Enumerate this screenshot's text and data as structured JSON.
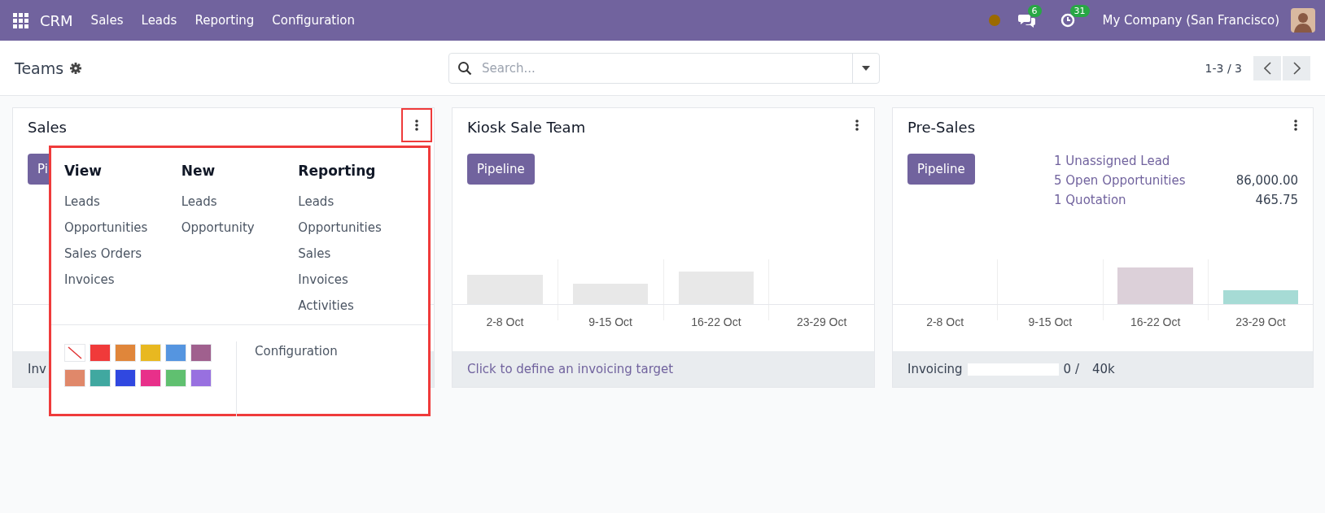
{
  "navbar": {
    "app": "CRM",
    "menus": [
      "Sales",
      "Leads",
      "Reporting",
      "Configuration"
    ],
    "messages_badge": "6",
    "activities_badge": "31",
    "company": "My Company (San Francisco)"
  },
  "control_panel": {
    "title": "Teams",
    "search": {
      "placeholder": "Search..."
    },
    "pager": "1-3 / 3"
  },
  "cards": [
    {
      "title": "Sales",
      "pipeline_button": "Pi",
      "menu_highlighted": true,
      "footer": {
        "kind": "text",
        "text": "Inv"
      },
      "dropdown": {
        "highlighted": true,
        "columns": [
          {
            "heading": "View",
            "items": [
              "Leads",
              "Opportunities",
              "Sales Orders",
              "Invoices"
            ]
          },
          {
            "heading": "New",
            "items": [
              "Leads",
              "Opportunity"
            ]
          },
          {
            "heading": "Reporting",
            "items": [
              "Leads",
              "Opportunities",
              "Sales",
              "Invoices",
              "Activities"
            ]
          }
        ],
        "swatches": [
          {
            "kind": "none"
          },
          {
            "kind": "color",
            "color": "#f03a3a"
          },
          {
            "kind": "color",
            "color": "#e0863a"
          },
          {
            "kind": "color",
            "color": "#e8b820"
          },
          {
            "kind": "color",
            "color": "#5595e0"
          },
          {
            "kind": "color",
            "color": "#a0608e"
          },
          {
            "kind": "color",
            "color": "#e0886a"
          },
          {
            "kind": "color",
            "color": "#40a8a0"
          },
          {
            "kind": "color",
            "color": "#3048e0"
          },
          {
            "kind": "color",
            "color": "#e8308a"
          },
          {
            "kind": "color",
            "color": "#60c070"
          },
          {
            "kind": "color",
            "color": "#9870e0"
          }
        ],
        "configuration": "Configuration"
      }
    },
    {
      "title": "Kiosk Sale Team",
      "pipeline_button": "Pipeline",
      "menu_highlighted": false,
      "x_labels": [
        "2-8 Oct",
        "9-15 Oct",
        "16-22 Oct",
        "23-29 Oct"
      ],
      "footer": {
        "kind": "link",
        "text": "Click to define an invoicing target"
      }
    },
    {
      "title": "Pre-Sales",
      "pipeline_button": "Pipeline",
      "menu_highlighted": false,
      "stats": [
        {
          "label": "1 Unassigned Lead"
        },
        {
          "label": "5 Open Opportunities",
          "value": "86,000.00"
        },
        {
          "label": "1 Quotation",
          "value": "465.75"
        }
      ],
      "x_labels": [
        "2-8 Oct",
        "9-15 Oct",
        "16-22 Oct",
        "23-29 Oct"
      ],
      "footer": {
        "kind": "progress",
        "text": "Invoicing",
        "level": 0,
        "reading": "0 /",
        "target": "40k"
      }
    }
  ]
}
